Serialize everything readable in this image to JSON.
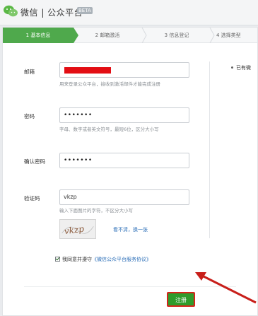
{
  "header": {
    "brand": "微信 | 公众平台",
    "beta_badge": "BETA"
  },
  "steps": [
    {
      "label": "1 基本信息",
      "active": true
    },
    {
      "label": "2 邮箱激活",
      "active": false
    },
    {
      "label": "3 信息登记",
      "active": false
    },
    {
      "label": "4 选择类型",
      "active": false
    }
  ],
  "form": {
    "email": {
      "label": "邮箱",
      "value_redacted": true,
      "hint": "用来登录公众平台，接收到激活邮件才能完成注册"
    },
    "password": {
      "label": "密码",
      "value": "•••••••",
      "hint": "字母、数字或者英文符号，最短6位，区分大小写"
    },
    "confirm_password": {
      "label": "确认密码",
      "value": "•••••••"
    },
    "captcha": {
      "label": "验证码",
      "value": "vkzp",
      "hint": "输入下面图片的字符，不区分大小写",
      "image_text": "vkzp",
      "refresh_link": "看不清，换一张"
    },
    "agreement": {
      "checked": true,
      "text": "我同意并遵守",
      "link": "《微信公众平台服务协议》"
    },
    "submit_label": "注册"
  },
  "side": {
    "note": "已有微"
  },
  "colors": {
    "accent_green": "#4fa94c",
    "button_green": "#2f9b2b",
    "highlight_red": "#d4251b",
    "link_blue": "#2c6fb8"
  }
}
